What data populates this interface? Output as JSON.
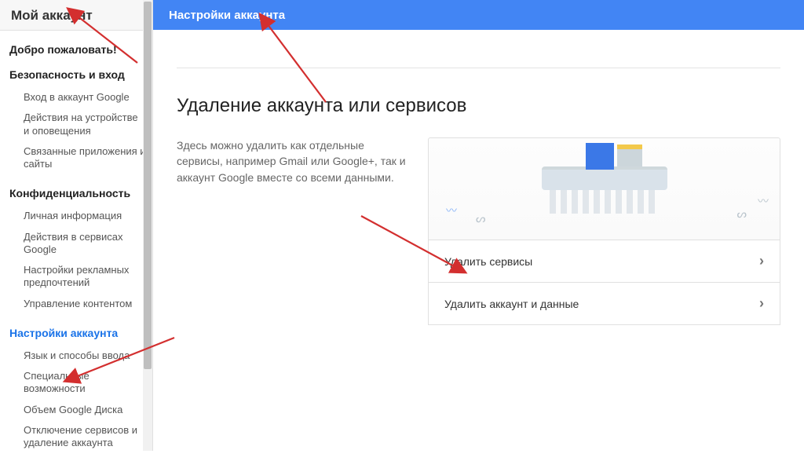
{
  "sidebar": {
    "header": "Мой аккаунт",
    "welcome": "Добро пожаловать!",
    "security_title": "Безопасность и вход",
    "security_items": [
      "Вход в аккаунт Google",
      "Действия на устройстве и оповещения",
      "Связанные приложения и сайты"
    ],
    "privacy_title": "Конфиденциальность",
    "privacy_items": [
      "Личная информация",
      "Действия в сервисах Google",
      "Настройки рекламных предпочтений",
      "Управление контентом"
    ],
    "settings_title": "Настройки аккаунта",
    "settings_items": [
      "Язык и способы ввода",
      "Специальные возможности",
      "Объем Google Диска",
      "Отключение сервисов и удаление аккаунта"
    ]
  },
  "topbar": {
    "title": "Настройки аккаунта"
  },
  "main": {
    "page_title": "Удаление аккаунта или сервисов",
    "intro": "Здесь можно удалить как отдельные сервисы, например Gmail или Google+, так и аккаунт Google вместе со всеми данными.",
    "option1": "Удалить сервисы",
    "option2": "Удалить аккаунт и данные"
  }
}
